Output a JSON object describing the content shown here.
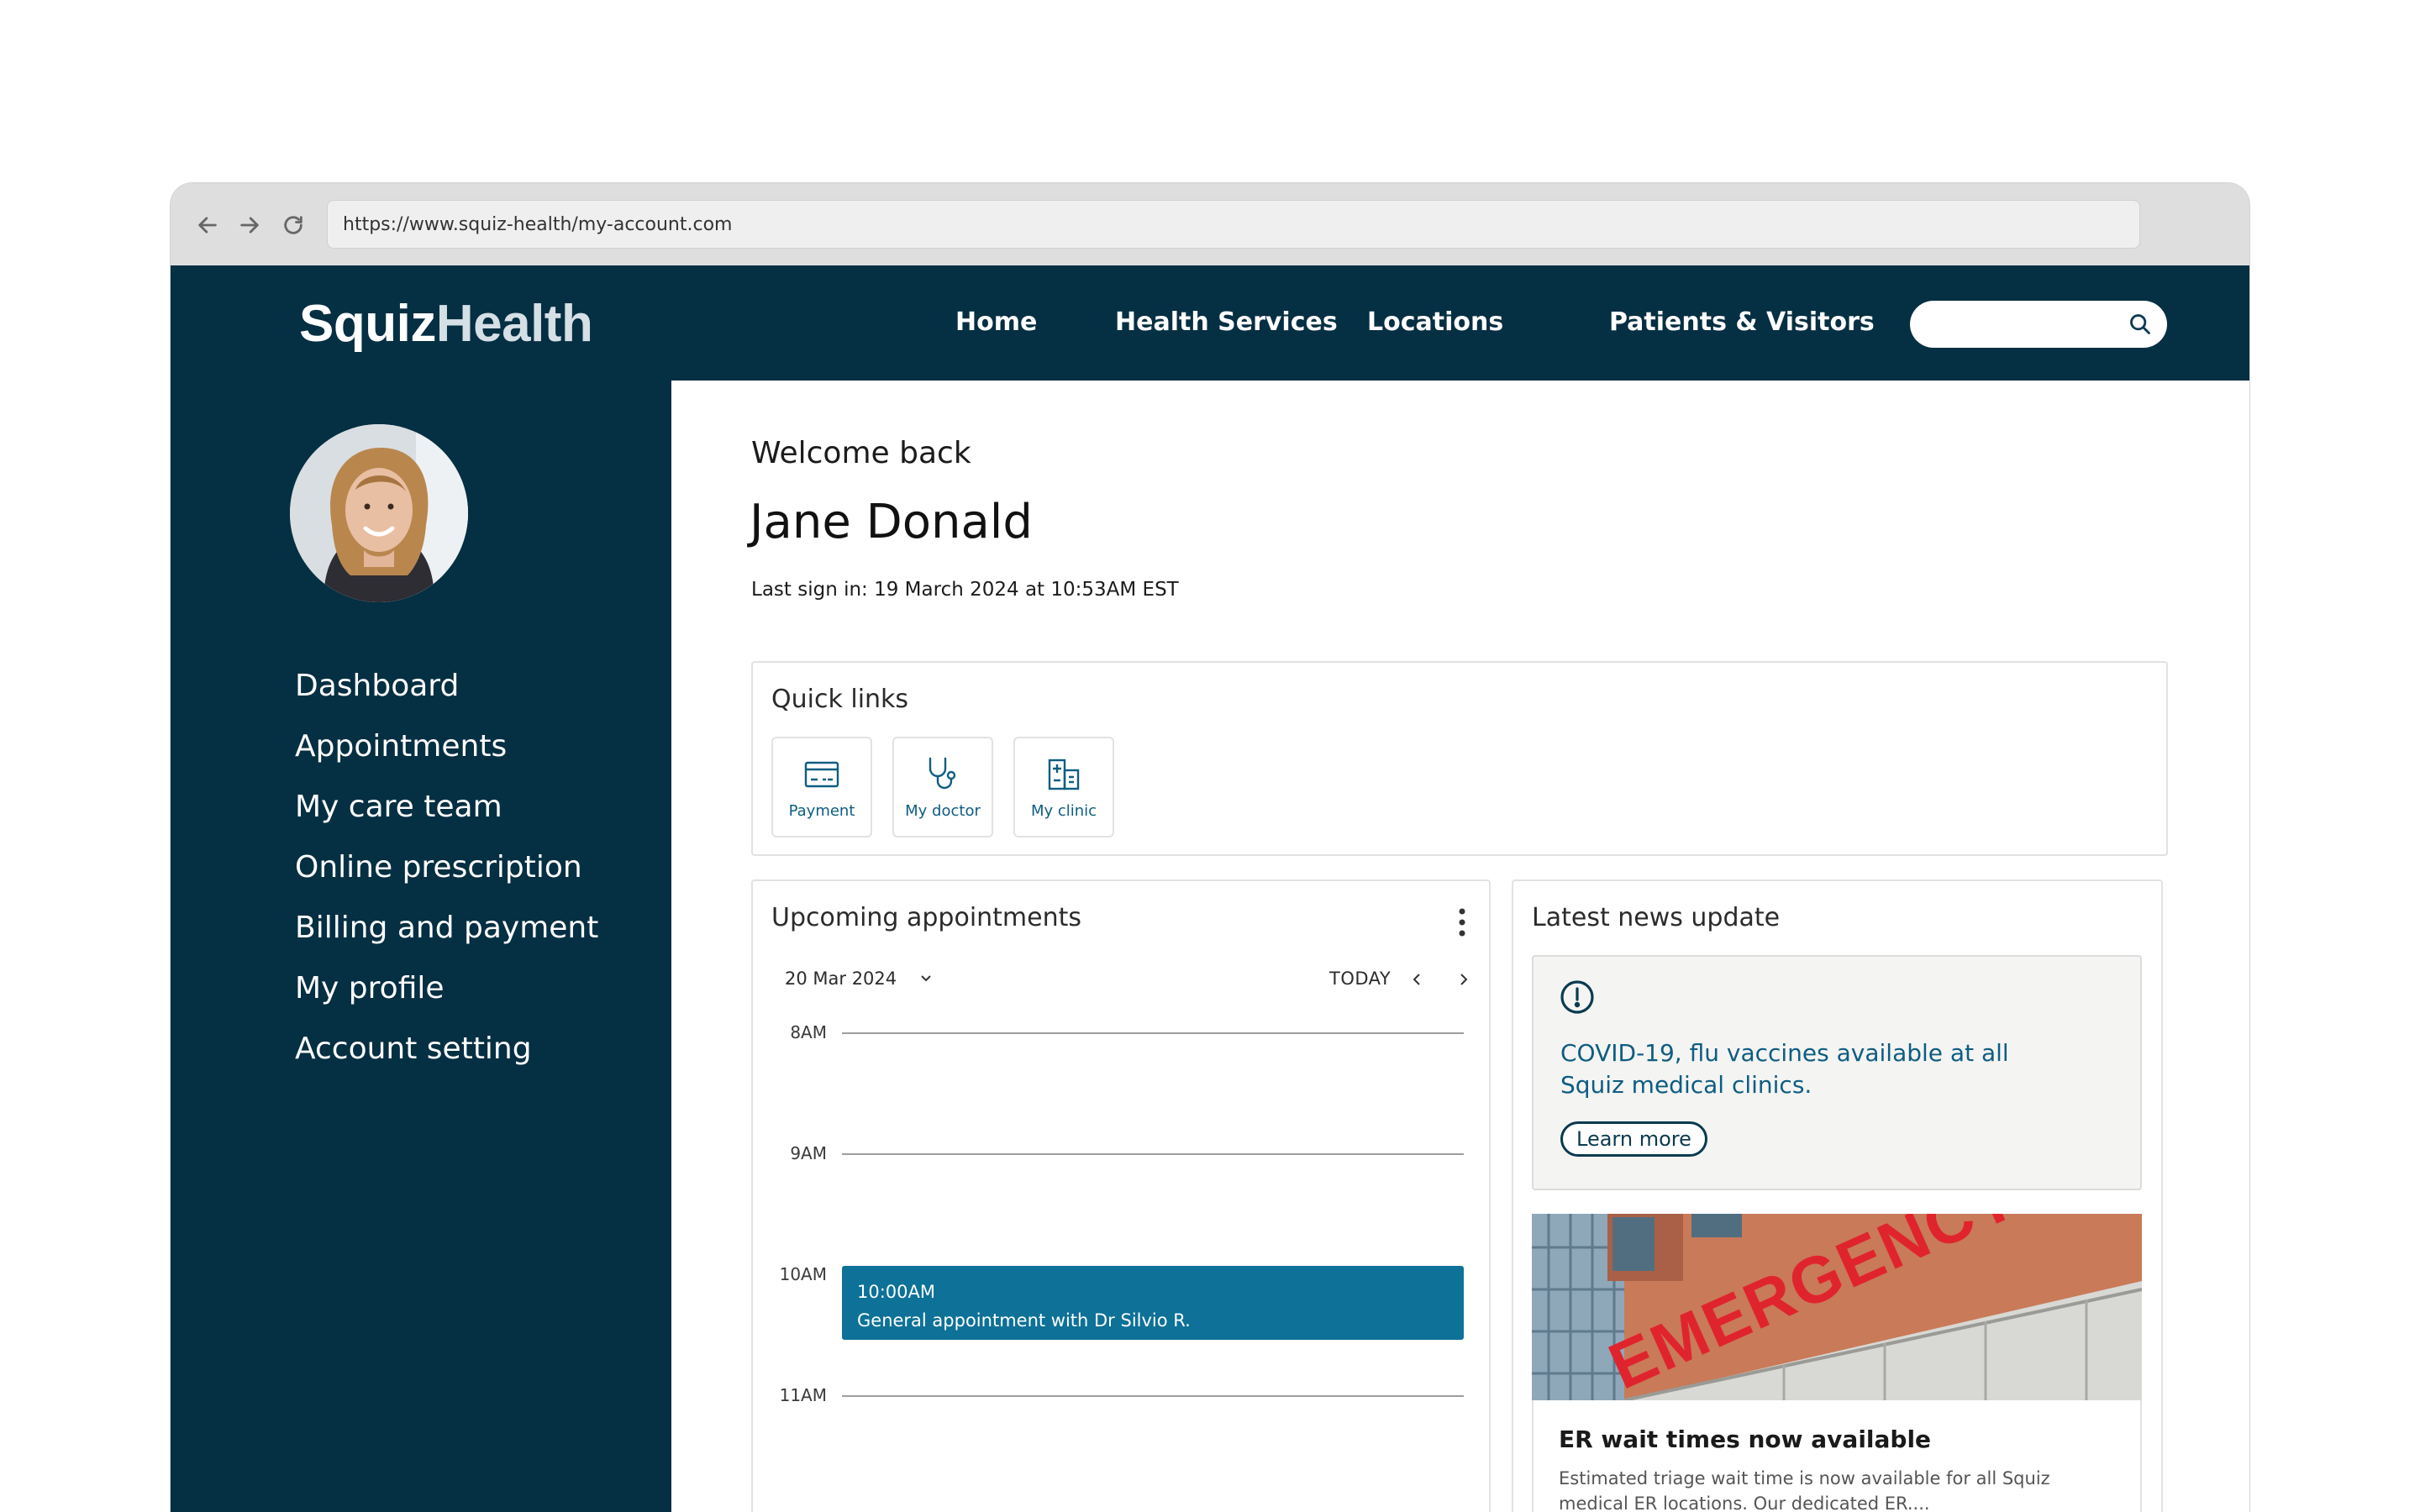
{
  "browser": {
    "url": "https://www.squiz-health/my-account.com"
  },
  "site": {
    "logo_primary": "Squiz",
    "logo_secondary": "Health",
    "nav": [
      "Home",
      "Health Services",
      "Locations",
      "Patients & Visitors"
    ],
    "search_placeholder": ""
  },
  "sidebar": {
    "items": [
      "Dashboard",
      "Appointments",
      "My care team",
      "Online prescription",
      "Billing and payment",
      "My profile",
      "Account setting"
    ]
  },
  "main": {
    "welcome": "Welcome back",
    "user_name": "Jane Donald",
    "last_sign_in": "Last sign in: 19 March 2024 at 10:53AM EST"
  },
  "quick_links": {
    "title": "Quick links",
    "items": [
      {
        "label": "Payment",
        "icon": "credit-card-icon"
      },
      {
        "label": "My doctor",
        "icon": "stethoscope-icon"
      },
      {
        "label": "My clinic",
        "icon": "clinic-building-icon"
      }
    ]
  },
  "appointments": {
    "title": "Upcoming appointments",
    "date": "20 Mar 2024",
    "today_label": "TODAY",
    "hours": [
      "8AM",
      "9AM",
      "10AM",
      "11AM"
    ],
    "event": {
      "time": "10:00AM",
      "description": "General appointment with Dr Silvio R."
    }
  },
  "news": {
    "title": "Latest news update",
    "alert_headline": "COVID-19, flu vaccines available at all Squiz medical clinics.",
    "alert_button": "Learn more",
    "article_title": "ER wait times now available",
    "article_desc": "Estimated triage wait time is now available for all Squiz medical ER locations. Our dedicated ER....",
    "image_sign": "EMERGENCY"
  },
  "colors": {
    "brand_dark": "#052f42",
    "accent": "#0d7198",
    "link": "#0e5d82"
  }
}
